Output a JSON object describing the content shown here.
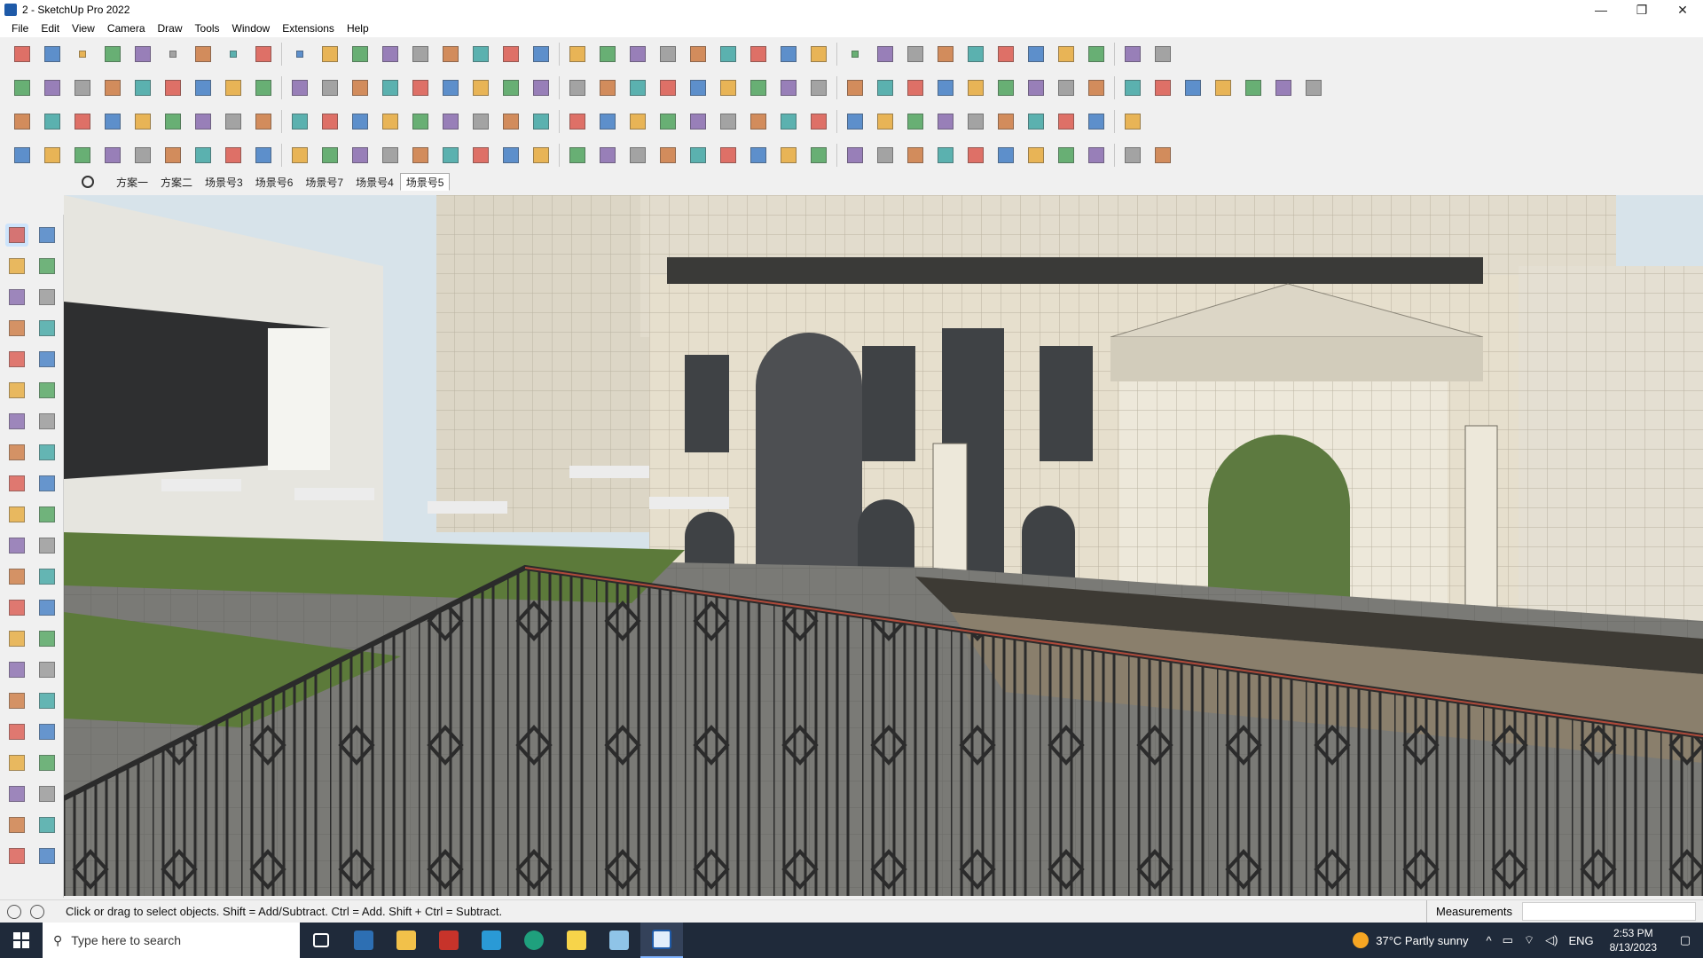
{
  "window": {
    "title": "2 - SketchUp Pro 2022",
    "minimize": "—",
    "maximize": "❐",
    "close": "✕"
  },
  "menu": [
    "File",
    "Edit",
    "View",
    "Camera",
    "Draw",
    "Tools",
    "Window",
    "Extensions",
    "Help"
  ],
  "scenes": {
    "tabs": [
      "方案一",
      "方案二",
      "场景号3",
      "场景号6",
      "场景号7",
      "场景号4",
      "场景号5"
    ],
    "active_index": 6
  },
  "toolbar_icons": {
    "row1": [
      "zoom-icon",
      "select-icon",
      "dropdown-icon",
      "eraser-icon",
      "pencil-icon",
      "dropdown-icon",
      "lasso-icon",
      "dropdown-icon",
      "rectangle-icon",
      "dropdown-icon",
      "push-pull-icon",
      "follow-me-icon",
      "move-icon",
      "rotate-icon",
      "scale-icon",
      "tape-measure-icon",
      "text-icon",
      "paint-bucket-icon",
      "orbit-icon",
      "pan-icon",
      "zoom-window-icon",
      "zoom-extents-icon",
      "iso-view-icon",
      "top-view-icon",
      "front-view-icon",
      "right-view-icon",
      "user-icon",
      "dropdown-icon",
      "layers-icon",
      "components-icon",
      "styles-icon",
      "up-down-icon",
      "sort-icon",
      "section-icon",
      "xray-icon",
      "undo-icon",
      "redo-icon",
      "info-icon"
    ],
    "row2": [
      "box-icon",
      "box-icon",
      "box-icon",
      "stamp-icon",
      "axis-icon",
      "axis-icon",
      "axis-icon",
      "axis-icon",
      "axis-icon",
      "axis-icon",
      "axis-icon",
      "curve-icon",
      "slash-icon",
      "slash-icon",
      "slash-icon",
      "sandbox-icon",
      "sandbox-icon",
      "house-icon",
      "house-icon",
      "house-icon",
      "house-icon",
      "house-icon",
      "text-tool-icon",
      "leaf-icon",
      "ruler-icon",
      "shape-icon",
      "shape-icon",
      "shape-icon",
      "shape-icon",
      "shape-icon",
      "shape-icon",
      "shape-icon",
      "shape-icon",
      "shape-icon",
      "arrow-icon",
      "tag-icon",
      "cube-icon",
      "cube-icon",
      "cube-icon",
      "cube-icon",
      "cube-icon",
      "cube-icon",
      "cube-icon"
    ],
    "row3": [
      "solid-icon",
      "solid-icon",
      "solid-icon",
      "solid-icon",
      "solid-icon",
      "solid-icon",
      "arc-icon",
      "solid-icon",
      "stack-icon",
      "window-icon",
      "link-icon",
      "hook-icon",
      "dots-icon",
      "plus-icon",
      "plus-icon",
      "cross-icon",
      "cone-icon",
      "cone-icon",
      "warning-icon",
      "rope-icon",
      "rope-icon",
      "rope-icon",
      "cursor-icon",
      "bucket-icon",
      "loop-icon",
      "tree-icon",
      "box-icon",
      "box-icon",
      "box-icon",
      "box-icon",
      "grid-icon",
      "grid-icon",
      "grid-icon",
      "grid-icon",
      "scatter-icon",
      "curve-icon",
      "grid-icon"
    ],
    "row4": [
      "path-icon",
      "path-icon",
      "car-icon",
      "scissors-icon",
      "gear-icon",
      "eye-icon",
      "brush-icon",
      "head-icon",
      "arrow-icon",
      "corner-icon",
      "corner-icon",
      "line-icon",
      "curve-icon",
      "stairs-icon",
      "cone-icon",
      "pillar-icon",
      "pillar-icon",
      "hand-icon",
      "leaf-icon",
      "leaf-icon",
      "leaf-icon",
      "slash-icon",
      "fork-icon",
      "fork-icon",
      "fork-icon",
      "building-icon",
      "stripe-icon",
      "door-icon",
      "door-icon",
      "grid-icon",
      "grid-icon",
      "grid-icon",
      "grid-icon",
      "gear-icon",
      "gear-icon",
      "stripe-icon",
      "stripe-icon",
      "house-icon"
    ]
  },
  "left_tools": [
    [
      "select-icon",
      "orbit-hand-icon"
    ],
    [
      "paint-bucket-icon",
      "eraser-icon"
    ],
    [
      "component-icon",
      "tape-icon"
    ],
    [
      "line-icon",
      "freehand-icon"
    ],
    [
      "rectangle-icon",
      "rotated-rectangle-icon"
    ],
    [
      "circle-icon",
      "polygon-icon"
    ],
    [
      "arc-icon",
      "pie-icon"
    ],
    [
      "two-point-arc-icon",
      "three-point-arc-icon"
    ],
    [
      "move-icon",
      "push-pull-icon"
    ],
    [
      "rotate-icon",
      "follow-me-icon"
    ],
    [
      "scale-icon",
      "offset-icon"
    ],
    [
      "tape-measure-icon",
      "dimension-icon"
    ],
    [
      "protractor-icon",
      "text-icon"
    ],
    [
      "axes-icon",
      "3d-text-icon"
    ],
    [
      "orbit-icon",
      "pan-icon"
    ],
    [
      "zoom-icon",
      "zoom-window-icon"
    ],
    [
      "zoom-extents-icon",
      "previous-view-icon"
    ],
    [
      "position-camera-icon",
      "look-around-icon"
    ],
    [
      "walk-icon",
      "section-plane-icon"
    ],
    [
      "sandbox-icon",
      "sandbox-icon"
    ],
    [
      "sandbox-icon",
      "sandbox-icon"
    ]
  ],
  "status": {
    "hint": "Click or drag to select objects. Shift = Add/Subtract. Ctrl = Add. Shift + Ctrl = Subtract.",
    "measurements_label": "Measurements",
    "measurements_value": ""
  },
  "taskbar": {
    "search_placeholder": "Type here to search",
    "weather": "37°C  Partly sunny",
    "lang": "ENG",
    "time": "2:53 PM",
    "date": "8/13/2023",
    "apps": [
      "task-view-icon",
      "calculator-icon",
      "file-explorer-icon",
      "acrobat-icon",
      "store-icon",
      "edge-icon",
      "sticky-notes-icon",
      "sketch-app-icon",
      "sketchup-icon"
    ]
  },
  "colors": {
    "accent": "#1e5aa8",
    "taskbar": "#1f2a3a",
    "sky": "#c9dbe8",
    "facade": "#e6dfcd",
    "paving": "#7a7a76",
    "grass": "#5c7a3a",
    "railing": "#2b2b2b"
  }
}
